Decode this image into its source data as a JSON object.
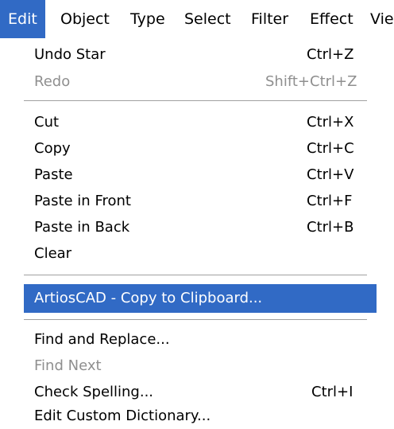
{
  "colors": {
    "highlight": "#316ac5",
    "highlight_text": "#ffffff",
    "disabled_text": "#8f8f8f",
    "separator": "#a0a0a0"
  },
  "menubar": {
    "items": [
      {
        "label": "Edit",
        "active": true
      },
      {
        "label": "Object"
      },
      {
        "label": "Type"
      },
      {
        "label": "Select"
      },
      {
        "label": "Filter"
      },
      {
        "label": "Effect"
      },
      {
        "label": "Vie"
      }
    ]
  },
  "edit_menu": {
    "items": [
      {
        "label": "Undo Star",
        "shortcut": "Ctrl+Z"
      },
      {
        "label": "Redo",
        "shortcut": "Shift+Ctrl+Z",
        "disabled": true
      },
      {
        "label": "Cut",
        "shortcut": "Ctrl+X"
      },
      {
        "label": "Copy",
        "shortcut": "Ctrl+C"
      },
      {
        "label": "Paste",
        "shortcut": "Ctrl+V"
      },
      {
        "label": "Paste in Front",
        "shortcut": "Ctrl+F"
      },
      {
        "label": "Paste in Back",
        "shortcut": "Ctrl+B"
      },
      {
        "label": "Clear"
      },
      {
        "label": "ArtiosCAD - Copy to Clipboard...",
        "highlighted": true
      },
      {
        "label": "Find and Replace..."
      },
      {
        "label": "Find Next",
        "disabled": true
      },
      {
        "label": "Check Spelling...",
        "shortcut": "Ctrl+I"
      },
      {
        "label": "Edit Custom Dictionary..."
      }
    ]
  }
}
